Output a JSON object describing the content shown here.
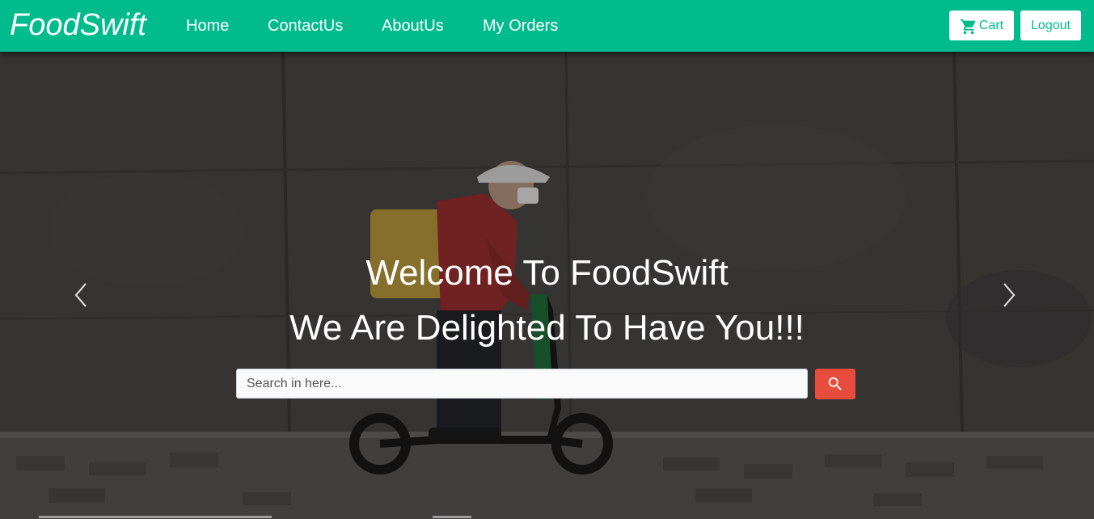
{
  "navbar": {
    "brand": "FoodSwift",
    "links": [
      "Home",
      "ContactUs",
      "AboutUs",
      "My Orders"
    ],
    "cart_label": "Cart",
    "logout_label": "Logout",
    "accent_color": "#00bc8c"
  },
  "hero": {
    "heading": "Welcome To FoodSwift",
    "subheading": "We Are Delighted To Have You!!!",
    "search": {
      "value": "",
      "placeholder": "Search in here..."
    },
    "search_button_color": "#e74c3c",
    "prev_icon": "chevron-left-icon",
    "next_icon": "chevron-right-icon"
  },
  "carousel": {
    "slide_count": 3,
    "active_slide": 1
  }
}
